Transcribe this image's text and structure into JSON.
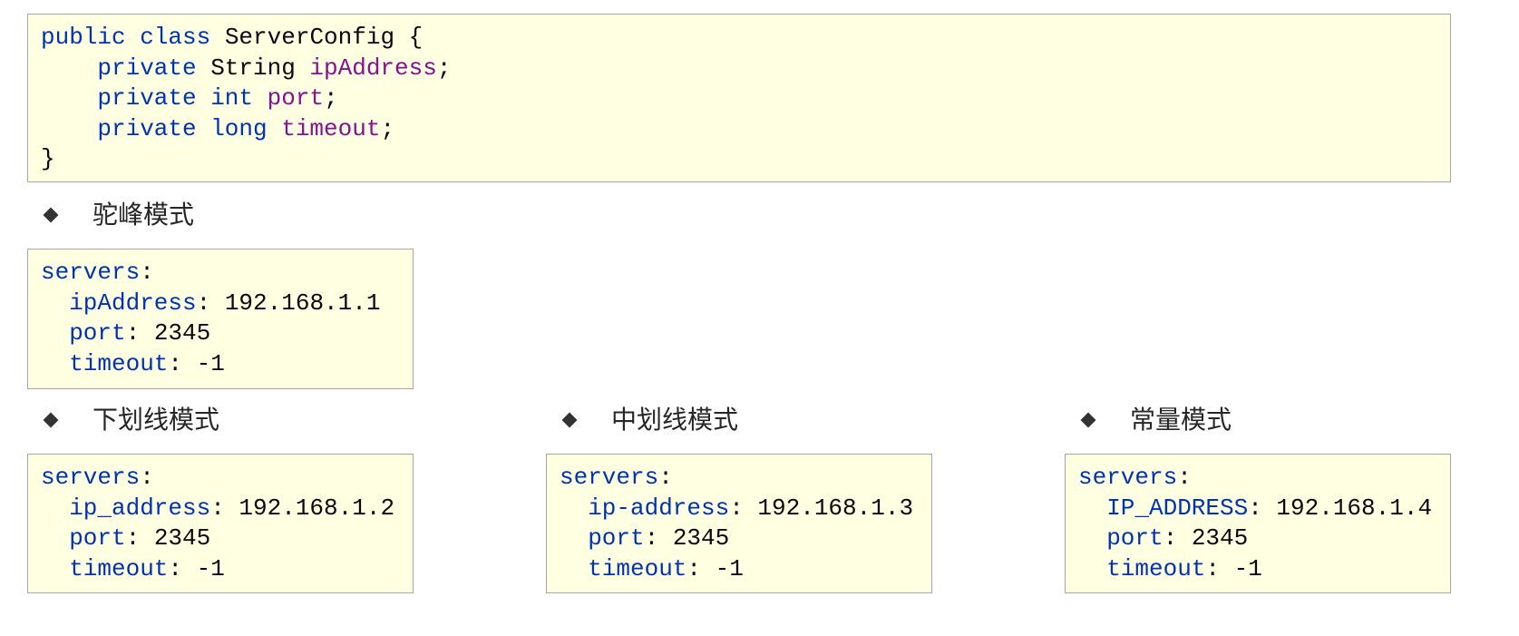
{
  "colors": {
    "keyword": "#0033B3",
    "field": "#871094",
    "text": "#080808",
    "yaml_key": "#0033B3",
    "box_background": "#FFFFE1",
    "box_border": "#A6A6A6",
    "heading": "#262626",
    "bullet": "#333333"
  },
  "icons": {
    "section_bullet": "diamond-bullet-icon"
  },
  "syntax": {
    "colon": ":",
    "semicolon": ";"
  },
  "java_class": {
    "modifier": "public",
    "keyword": "class",
    "name": "ServerConfig",
    "open_brace": "{",
    "close_brace": "}",
    "fields": [
      {
        "modifier": "private",
        "type": "String",
        "name": "ipAddress"
      },
      {
        "modifier": "private",
        "type": "int",
        "name": "port"
      },
      {
        "modifier": "private",
        "type": "long",
        "name": "timeout"
      }
    ]
  },
  "naming_styles": [
    {
      "heading": "驼峰模式",
      "root_key": "servers",
      "entries": [
        {
          "key": "ipAddress",
          "value": "192.168.1.1"
        },
        {
          "key": "port",
          "value": "2345"
        },
        {
          "key": "timeout",
          "value": "-1"
        }
      ]
    },
    {
      "heading": "下划线模式",
      "root_key": "servers",
      "entries": [
        {
          "key": "ip_address",
          "value": "192.168.1.2"
        },
        {
          "key": "port",
          "value": "2345"
        },
        {
          "key": "timeout",
          "value": "-1"
        }
      ]
    },
    {
      "heading": "中划线模式",
      "root_key": "servers",
      "entries": [
        {
          "key": "ip-address",
          "value": "192.168.1.3"
        },
        {
          "key": "port",
          "value": "2345"
        },
        {
          "key": "timeout",
          "value": "-1"
        }
      ]
    },
    {
      "heading": "常量模式",
      "root_key": "servers",
      "entries": [
        {
          "key": "IP_ADDRESS",
          "value": "192.168.1.4"
        },
        {
          "key": "port",
          "value": "2345"
        },
        {
          "key": "timeout",
          "value": "-1"
        }
      ]
    }
  ]
}
